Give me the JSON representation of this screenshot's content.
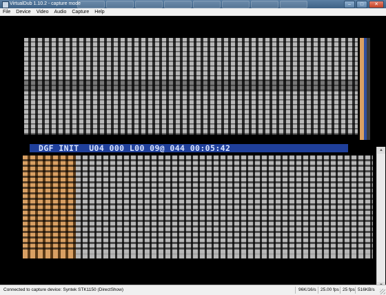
{
  "window": {
    "title": "VirtualDub 1.10.2 - capture mode"
  },
  "menu": [
    {
      "label": "File"
    },
    {
      "label": "Device"
    },
    {
      "label": "Video"
    },
    {
      "label": "Audio"
    },
    {
      "label": "Capture"
    },
    {
      "label": "Help"
    }
  ],
  "video": {
    "osd_text": "DGF INIT  U04 000 L00 09@ 044 00:05:42",
    "colors": {
      "osd_bar": "#1f3f9a",
      "osd_text": "#d6e2ff",
      "bar_light": "#b8b8b8",
      "bar_dark": "#2a2a2a",
      "accent_orange": "#d9a063",
      "accent_blue": "#2f4fa0"
    }
  },
  "status": {
    "device": "Connected to capture device: Syntek STK1150 (DirectShow)",
    "audio_rate": "96K/16/s",
    "fps_target": "25.00 fps",
    "fps_actual": "25 fps",
    "data_rate": "516KB/s"
  }
}
